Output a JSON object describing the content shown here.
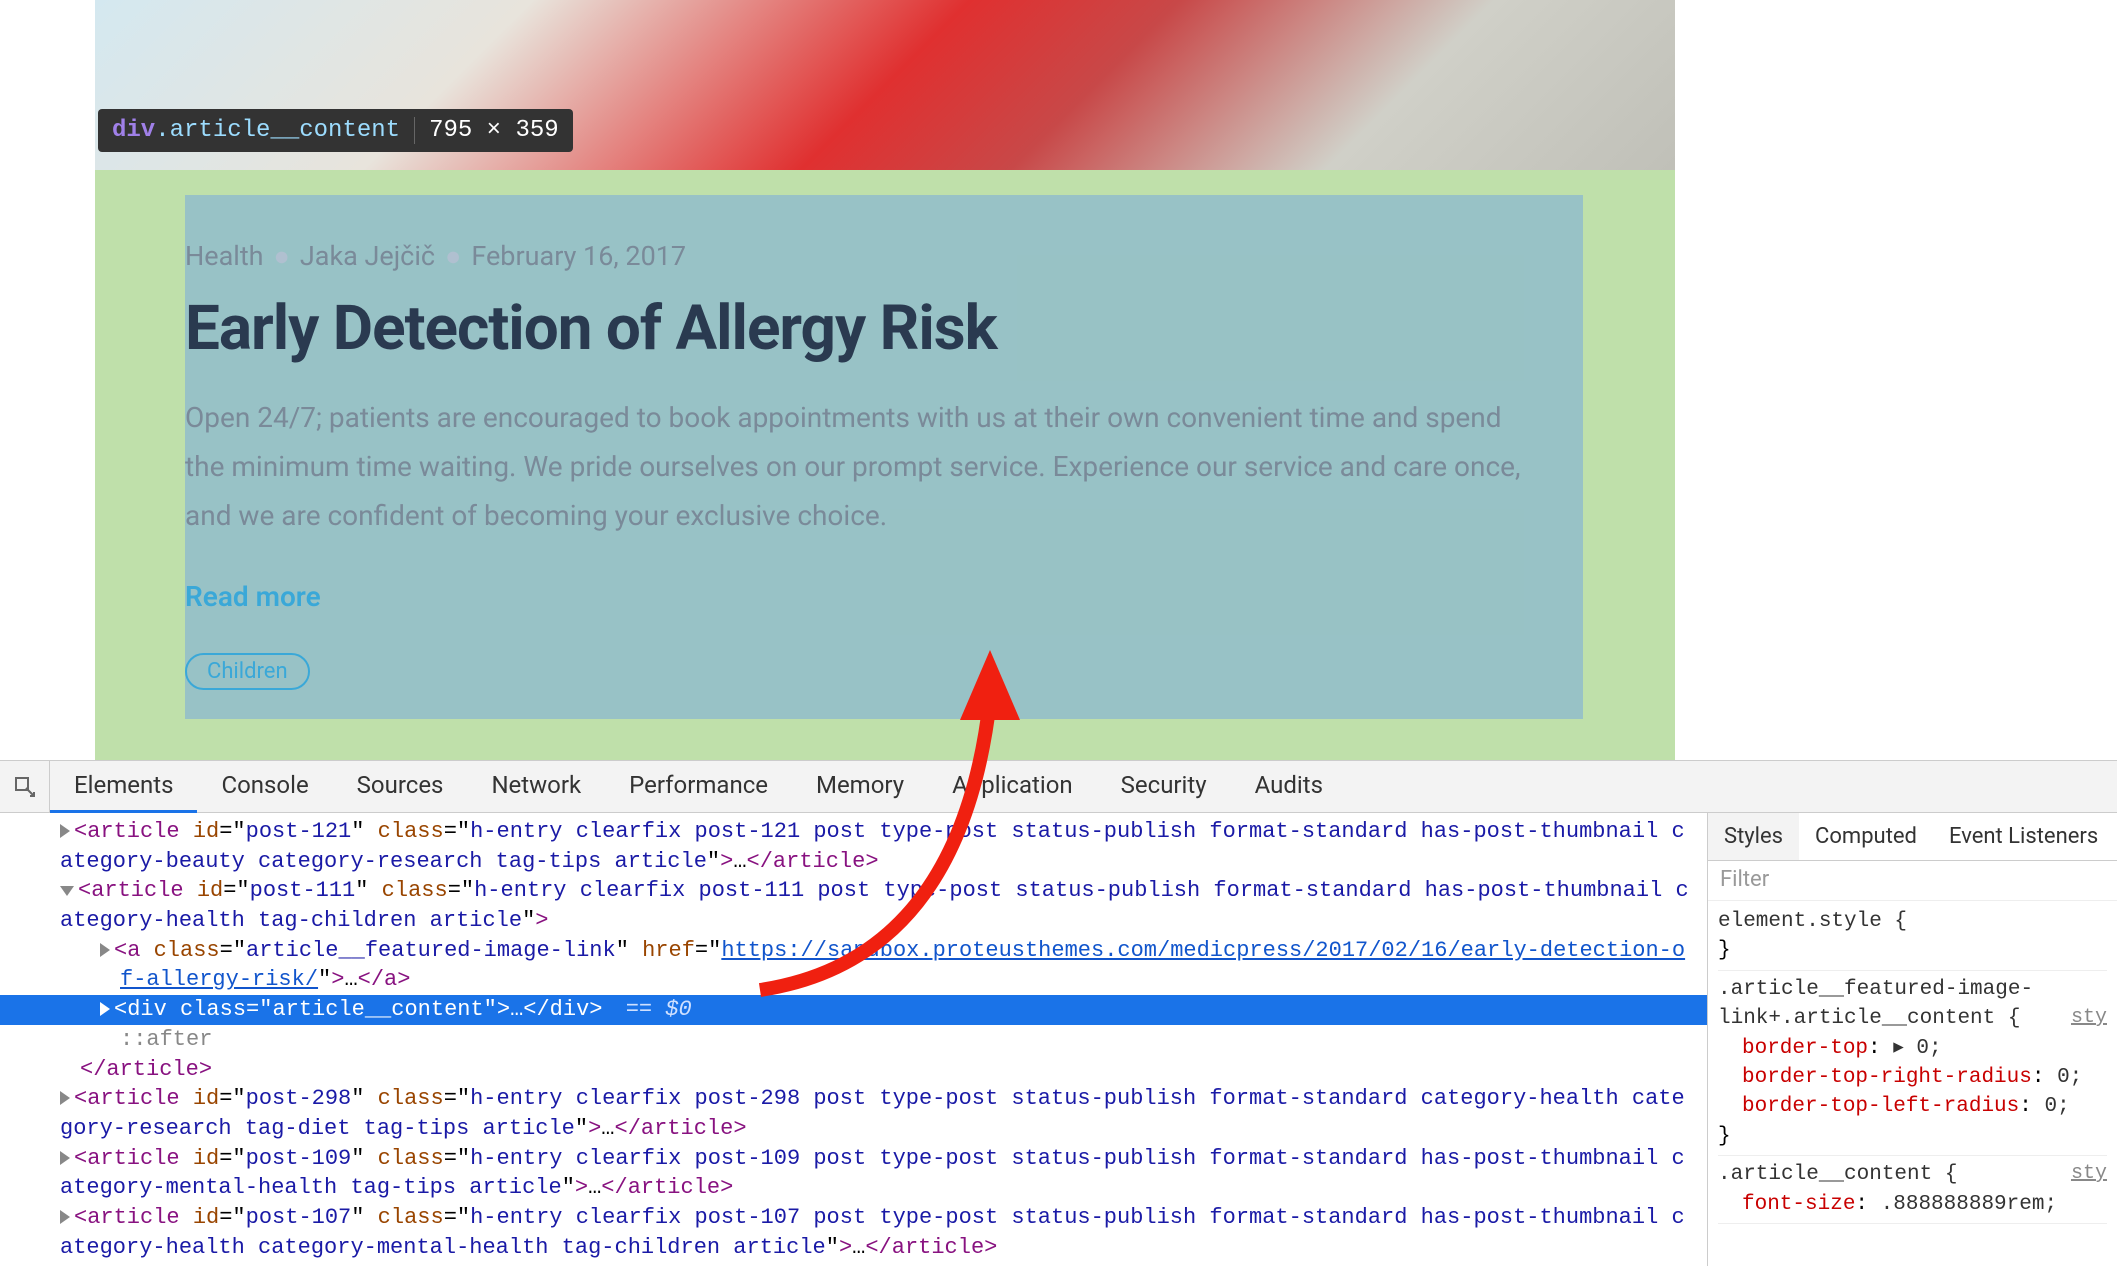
{
  "inspector_tooltip": {
    "tag": "div",
    "cls": ".article__content",
    "dims": "795 × 359"
  },
  "article": {
    "meta": {
      "category": "Health",
      "author": "Jaka Jejčič",
      "date": "February 16, 2017"
    },
    "title": "Early Detection of Allergy Risk",
    "excerpt": "Open 24/7; patients are encouraged to book appointments with us at their own convenient time and spend the minimum time waiting. We pride ourselves on our prompt service. Experience our service and care once, and we are confident of becoming your exclusive choice.",
    "read_more": "Read more",
    "tag_pill": "Children"
  },
  "devtools": {
    "tabs": [
      "Elements",
      "Console",
      "Sources",
      "Network",
      "Performance",
      "Memory",
      "Application",
      "Security",
      "Audits"
    ],
    "dom_lines": [
      {
        "indent": 0,
        "caret": "right",
        "html": "<span class='tg'>&lt;article</span> <span class='at'>id</span>=\"<span class='vl'>post-121</span>\" <span class='at'>class</span>=\"<span class='vl'>h-entry clearfix post-121 post type-post status-publish format-standard has-post-thumbnail category-beauty category-research tag-tips article</span>\"<span class='tg'>&gt;</span>…<span class='tg'>&lt;/article&gt;</span>"
      },
      {
        "indent": 0,
        "caret": "down",
        "html": "<span class='tg'>&lt;article</span> <span class='at'>id</span>=\"<span class='vl'>post-111</span>\" <span class='at'>class</span>=\"<span class='vl'>h-entry clearfix post-111 post type-post status-publish format-standard has-post-thumbnail category-health tag-children article</span>\"<span class='tg'>&gt;</span>"
      },
      {
        "indent": 2,
        "caret": "right",
        "html": "<span class='tg'>&lt;a</span> <span class='at'>class</span>=\"<span class='vl'>article__featured-image-link</span>\" <span class='at'>href</span>=\"<span class='lk'>https://sandbox.proteusthemes.com/medicpress/2017/02/16/early-detection-of-allergy-risk/</span>\"<span class='tg'>&gt;</span>…<span class='tg'>&lt;/a&gt;</span>"
      },
      {
        "indent": 2,
        "caret": "right",
        "selected": true,
        "html": "<span class='tg'>&lt;div</span> <span class='at'>class</span>=\"<span class='vl'>article__content</span>\"<span class='tg'>&gt;</span>…<span class='tg'>&lt;/div&gt;</span><span class='eq0'> == $0</span>"
      },
      {
        "pseudo": true,
        "html": "::after"
      },
      {
        "indent": 1,
        "html": "<span class='tg'>&lt;/article&gt;</span>"
      },
      {
        "indent": 0,
        "caret": "right",
        "html": "<span class='tg'>&lt;article</span> <span class='at'>id</span>=\"<span class='vl'>post-298</span>\" <span class='at'>class</span>=\"<span class='vl'>h-entry clearfix post-298 post type-post status-publish format-standard category-health category-research tag-diet tag-tips article</span>\"<span class='tg'>&gt;</span>…<span class='tg'>&lt;/article&gt;</span>"
      },
      {
        "indent": 0,
        "caret": "right",
        "html": "<span class='tg'>&lt;article</span> <span class='at'>id</span>=\"<span class='vl'>post-109</span>\" <span class='at'>class</span>=\"<span class='vl'>h-entry clearfix post-109 post type-post status-publish format-standard has-post-thumbnail category-mental-health tag-tips article</span>\"<span class='tg'>&gt;</span>…<span class='tg'>&lt;/article&gt;</span>"
      },
      {
        "indent": 0,
        "caret": "right",
        "html": "<span class='tg'>&lt;article</span> <span class='at'>id</span>=\"<span class='vl'>post-107</span>\" <span class='at'>class</span>=\"<span class='vl'>h-entry clearfix post-107 post type-post status-publish format-standard has-post-thumbnail category-health category-mental-health tag-children article</span>\"<span class='tg'>&gt;</span>…<span class='tg'>&lt;/article&gt;</span>"
      }
    ],
    "styles_tabs": [
      "Styles",
      "Computed",
      "Event Listeners"
    ],
    "filter_placeholder": "Filter",
    "rules": [
      {
        "selector": "element.style {",
        "link": "",
        "body": [],
        "close": "}"
      },
      {
        "selector": ".article__featured-image-link+.article__content {",
        "link": "sty",
        "body": [
          {
            "p": "border-top",
            "v": "▸ 0;"
          },
          {
            "p": "border-top-right-radius",
            "v": "0;"
          },
          {
            "p": "border-top-left-radius",
            "v": "0;"
          }
        ],
        "close": "}"
      },
      {
        "selector": ".article__content {",
        "link": "sty",
        "body": [
          {
            "p": "font-size",
            "v": ".888888889rem;"
          }
        ],
        "close": ""
      }
    ]
  }
}
